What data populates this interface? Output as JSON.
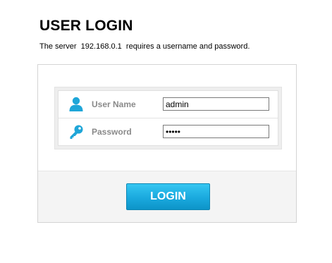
{
  "header": {
    "title": "USER LOGIN",
    "subtitle": "The server  192.168.0.1  requires a username and password."
  },
  "form": {
    "username": {
      "label": "User Name",
      "value": "admin",
      "icon": "user-icon"
    },
    "password": {
      "label": "Password",
      "value": "admin",
      "icon": "key-icon"
    },
    "submit_label": "LOGIN"
  },
  "colors": {
    "accent": "#1aa9de",
    "icon": "#1fa6d8"
  }
}
